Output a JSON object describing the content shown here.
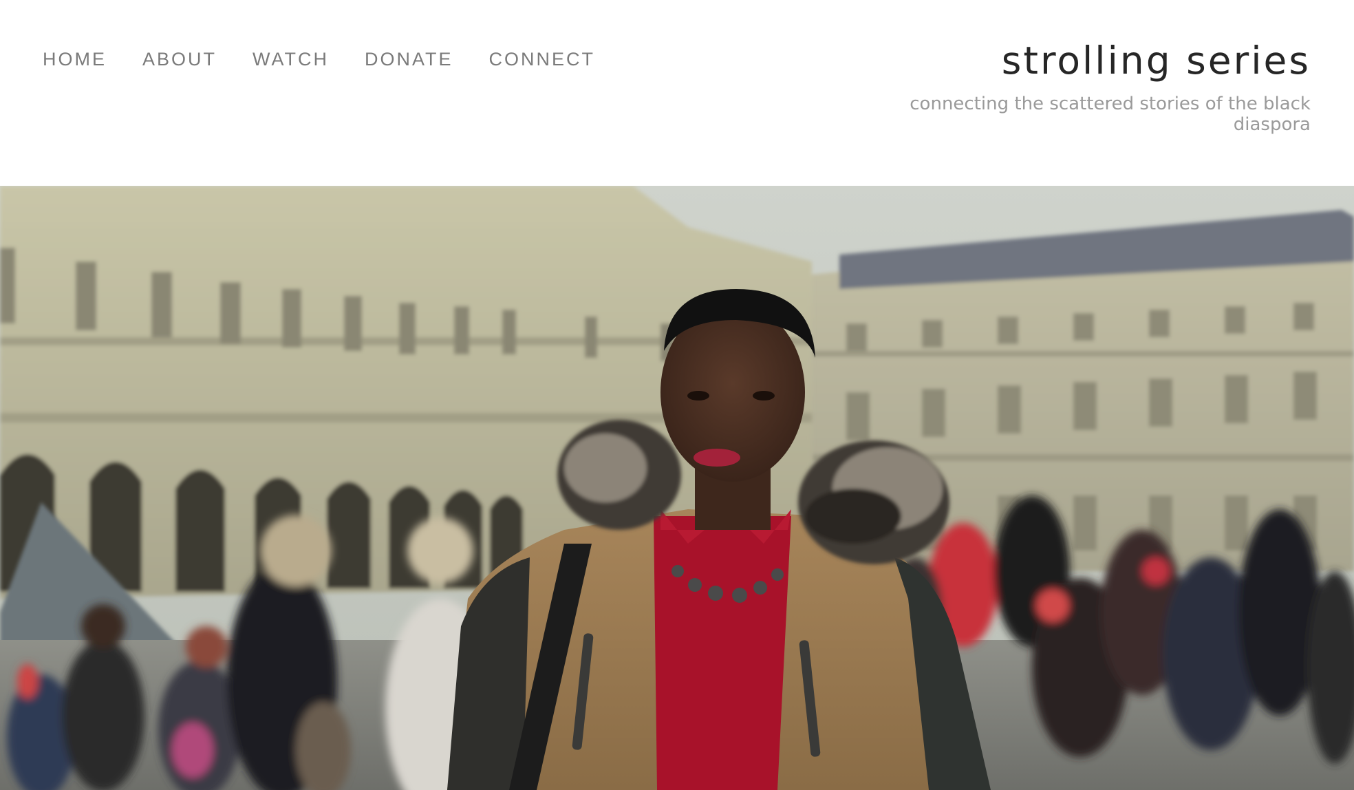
{
  "nav": {
    "items": [
      {
        "label": "HOME"
      },
      {
        "label": "ABOUT"
      },
      {
        "label": "WATCH"
      },
      {
        "label": "DONATE"
      },
      {
        "label": "CONNECT"
      }
    ]
  },
  "brand": {
    "title": "strolling series",
    "tagline": "connecting the scattered stories of the black diaspora"
  },
  "colors": {
    "nav_text": "#7a7a7a",
    "title_text": "#262626",
    "tagline_text": "#9a9a9a",
    "background": "#ffffff"
  }
}
